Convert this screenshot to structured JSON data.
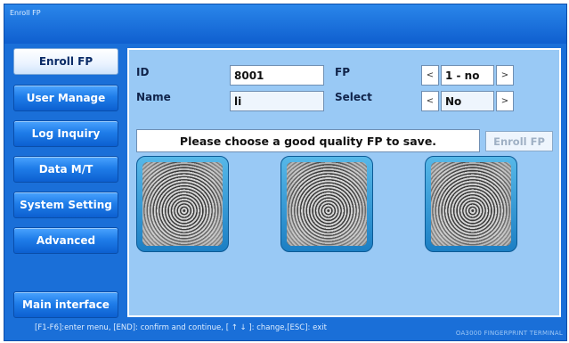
{
  "window": {
    "title": "Enroll FP"
  },
  "sidebar": {
    "items": [
      {
        "label": "Enroll FP",
        "active": true
      },
      {
        "label": "User Manage"
      },
      {
        "label": "Log Inquiry"
      },
      {
        "label": "Data M/T"
      },
      {
        "label": "System Setting"
      },
      {
        "label": "Advanced"
      }
    ],
    "main_interface": "Main interface"
  },
  "form": {
    "id_label": "ID",
    "id_value": "8001",
    "name_label": "Name",
    "name_value": "li",
    "fp_label": "FP",
    "fp_value": "1 - no",
    "select_label": "Select",
    "select_value": "No",
    "prev_arrow": "<",
    "next_arrow": ">"
  },
  "message": "Please choose a good quality FP to save.",
  "enroll_button": "Enroll FP",
  "fingerprints": [
    {
      "icon": "fingerprint-image"
    },
    {
      "icon": "fingerprint-image"
    },
    {
      "icon": "fingerprint-image"
    }
  ],
  "status": {
    "hint": "[F1-F6]:enter menu, [END]: confirm and continue, [ ↑ ↓ ]: change,[ESC]: exit",
    "brand": "OA3000 FINGERPRINT TERMINAL"
  },
  "colors": {
    "window_blue": "#1a6fd8",
    "panel_bg": "#99c9f5",
    "button_blue": "#1f7de9"
  }
}
